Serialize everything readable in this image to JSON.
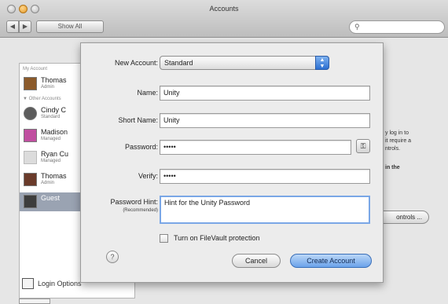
{
  "window": {
    "title": "Accounts",
    "show_all": "Show All",
    "back": "◀",
    "forward": "▶",
    "search_placeholder": ""
  },
  "sidebar": {
    "my_account_header": "My Account",
    "other_accounts_header": "▼ Other Accounts",
    "items": [
      {
        "name": "Thomas",
        "sub": "Admin",
        "avatar_color": "#8b5a2b"
      },
      {
        "name": "Cindy C",
        "sub": "Standard",
        "avatar_color": "#5c5c5c"
      },
      {
        "name": "Madison",
        "sub": "Managed",
        "avatar_color": "#c04fa0"
      },
      {
        "name": "Ryan Cu",
        "sub": "Managed",
        "avatar_color": "#dcdcdc"
      },
      {
        "name": "Thomas",
        "sub": "Admin",
        "avatar_color": "#6a3b2a"
      },
      {
        "name": "Guest",
        "sub": "",
        "avatar_color": "#3d3d3d"
      }
    ],
    "login_options": "Login Options"
  },
  "background_text": {
    "line1": "y log in to",
    "line2": "it require a",
    "line3": "ntrols.",
    "line4": "in the",
    "controls_button": "ontrols ..."
  },
  "sheet": {
    "new_account_label": "New Account:",
    "new_account_value": "Standard",
    "name_label": "Name:",
    "name_value": "Unity",
    "short_name_label": "Short Name:",
    "short_name_value": "Unity",
    "password_label": "Password:",
    "password_value": "•••••",
    "verify_label": "Verify:",
    "verify_value": "•••••",
    "hint_label": "Password Hint:",
    "hint_sub": "(Recommended)",
    "hint_value": "Hint for the Unity Password",
    "filevault_label": "Turn on FileVault protection",
    "help": "?",
    "cancel": "Cancel",
    "create": "Create Account",
    "key_icon": "key-icon"
  }
}
